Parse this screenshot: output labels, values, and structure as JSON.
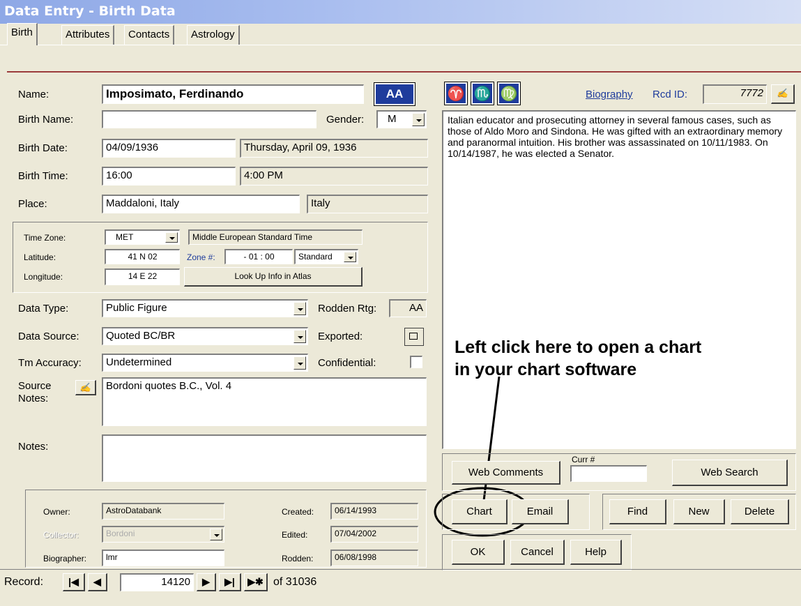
{
  "window": {
    "title": "Data Entry - Birth Data"
  },
  "tabs": [
    "Birth",
    "Attributes",
    "Contacts",
    "Astrology"
  ],
  "name": {
    "label": "Name:",
    "value": "Imposimato, Ferdinando",
    "aa_badge": "AA"
  },
  "birth_name": {
    "label": "Birth Name:",
    "value": ""
  },
  "gender": {
    "label": "Gender:",
    "value": "M"
  },
  "birth_date": {
    "label": "Birth Date:",
    "value": "04/09/1936",
    "long": "Thursday, April 09, 1936"
  },
  "birth_time": {
    "label": "Birth Time:",
    "value": "16:00",
    "display": "4:00 PM"
  },
  "place": {
    "label": "Place:",
    "value": "Maddaloni, Italy",
    "country": "Italy"
  },
  "timezone": {
    "tz_label": "Time Zone:",
    "tz_value": "MET",
    "tz_desc": "Middle European Standard Time",
    "lat_label": "Latitude:",
    "lat_value": "41 N 02",
    "zone_label": "Zone #:",
    "zone_value": "- 01 : 00",
    "zone_type": "Standard",
    "lon_label": "Longitude:",
    "lon_value": "14 E 22",
    "atlas_button": "Look Up Info in Atlas"
  },
  "data_type": {
    "label": "Data Type:",
    "value": "Public Figure"
  },
  "rodden": {
    "label": "Rodden Rtg:",
    "value": "AA"
  },
  "data_source": {
    "label": "Data Source:",
    "value": "Quoted BC/BR"
  },
  "exported": {
    "label": "Exported:"
  },
  "tm_accuracy": {
    "label": "Tm Accuracy:",
    "value": "Undetermined"
  },
  "confidential": {
    "label": "Confidential:"
  },
  "source_notes": {
    "label1": "Source",
    "label2": "Notes:",
    "value": "Bordoni quotes B.C., Vol. 4"
  },
  "notes": {
    "label": "Notes:",
    "value": ""
  },
  "meta": {
    "owner_label": "Owner:",
    "owner_value": "AstroDatabank",
    "collector_label": "Collector:",
    "collector_value": "Bordoni",
    "biographer_label": "Biographer:",
    "biographer_value": "lmr",
    "created_label": "Created:",
    "created_value": "06/14/1993",
    "edited_label": "Edited:",
    "edited_value": "07/04/2002",
    "rodden_label": "Rodden:",
    "rodden_value": "06/08/1998"
  },
  "zodiac": [
    "♈",
    "♏",
    "♍"
  ],
  "biography": {
    "link": "Biography",
    "rcd_label": "Rcd ID:",
    "rcd_value": "7772",
    "text": "Italian educator and prosecuting attorney in several famous cases, such as those of Aldo Moro and Sindona. He was gifted with an extraordinary memory and paranormal intuition.  His brother was assassinated on 10/11/1983.  On 10/14/1987, he was elected a Senator."
  },
  "annotation": {
    "line1": "Left click here to open a chart",
    "line2": "in your chart software"
  },
  "buttons": {
    "web_comments": "Web Comments",
    "curr_label": "Curr #",
    "web_search": "Web Search",
    "chart": "Chart",
    "email": "Email",
    "find": "Find",
    "new": "New",
    "delete": "Delete",
    "ok": "OK",
    "cancel": "Cancel",
    "help": "Help"
  },
  "record_nav": {
    "label": "Record:",
    "current": "14120",
    "total": "of 31036"
  },
  "colors": {
    "accent_blue": "#1F3C9C",
    "separator": "#9B3B3B",
    "window_bg": "#ECE9D8"
  }
}
